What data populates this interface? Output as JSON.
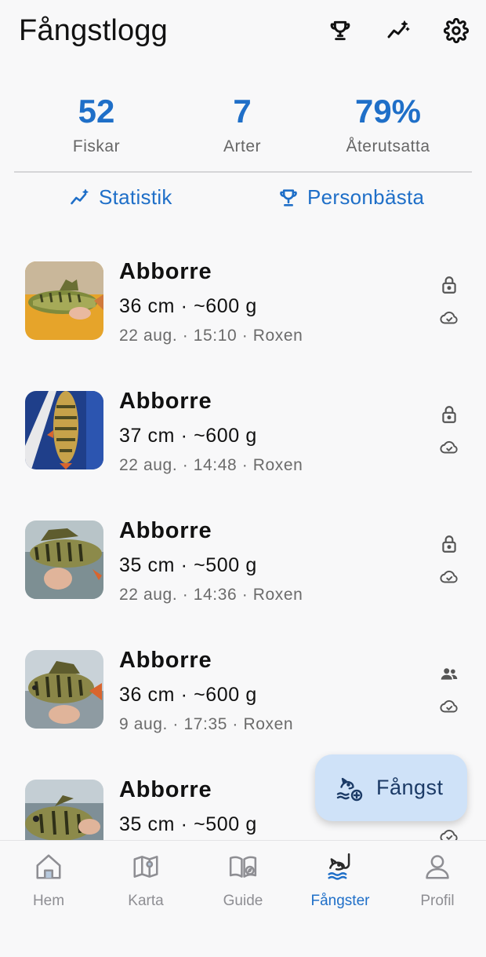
{
  "header": {
    "title": "Fångstlogg",
    "icons": [
      "trophy-icon",
      "sparkle-trend-icon",
      "gear-icon"
    ]
  },
  "stats": [
    {
      "value": "52",
      "label": "Fiskar"
    },
    {
      "value": "7",
      "label": "Arter"
    },
    {
      "value": "79%",
      "label": "Återutsatta"
    }
  ],
  "links": {
    "statistics": "Statistik",
    "personal_best": "Personbästa"
  },
  "catches": [
    {
      "species": "Abborre",
      "measure": "36 cm · ~600 g",
      "meta": "22 aug. · 15:10 · Roxen",
      "privacy_icon": "lock-icon",
      "sync_icon": "cloud-check-icon"
    },
    {
      "species": "Abborre",
      "measure": "37 cm · ~600 g",
      "meta": "22 aug. · 14:48 · Roxen",
      "privacy_icon": "lock-icon",
      "sync_icon": "cloud-check-icon"
    },
    {
      "species": "Abborre",
      "measure": "35 cm · ~500 g",
      "meta": "22 aug. · 14:36 · Roxen",
      "privacy_icon": "lock-icon",
      "sync_icon": "cloud-check-icon"
    },
    {
      "species": "Abborre",
      "measure": "36 cm · ~600 g",
      "meta": "9 aug. · 17:35 · Roxen",
      "privacy_icon": "people-icon",
      "sync_icon": "cloud-check-icon"
    },
    {
      "species": "Abborre",
      "measure": "35 cm · ~500 g",
      "meta": "",
      "privacy_icon": "",
      "sync_icon": "cloud-check-icon"
    }
  ],
  "fab": {
    "label": "Fångst"
  },
  "tabs": [
    {
      "label": "Hem",
      "icon": "home-icon",
      "active": false
    },
    {
      "label": "Karta",
      "icon": "map-icon",
      "active": false
    },
    {
      "label": "Guide",
      "icon": "book-icon",
      "active": false
    },
    {
      "label": "Fångster",
      "icon": "fish-hook-icon",
      "active": true
    },
    {
      "label": "Profil",
      "icon": "person-icon",
      "active": false
    }
  ],
  "colors": {
    "accent": "#1f6fc8",
    "fab_bg": "#cfe2f8",
    "muted": "#6b6b6b"
  }
}
